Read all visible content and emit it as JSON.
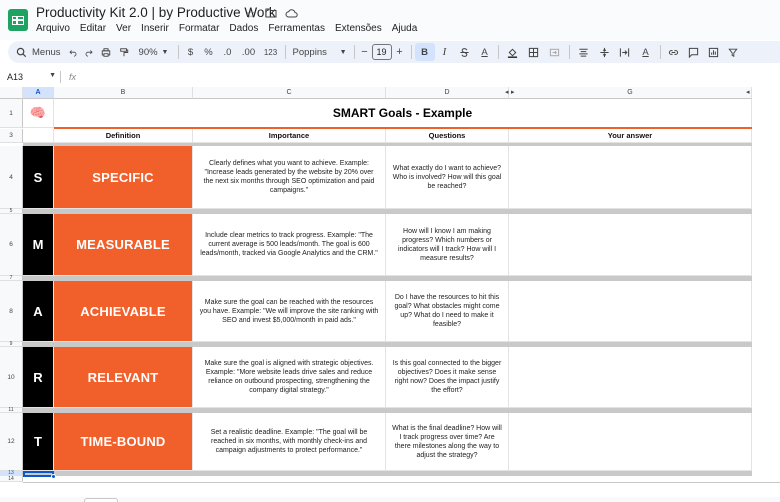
{
  "app": {
    "title": "Productivity Kit 2.0 | by Productive Work",
    "icons": [
      "star-icon",
      "folder-icon",
      "cloud-icon"
    ]
  },
  "menu": [
    "Arquivo",
    "Editar",
    "Ver",
    "Inserir",
    "Formatar",
    "Dados",
    "Ferramentas",
    "Extensões",
    "Ajuda"
  ],
  "toolbar": {
    "search_label": "Menus",
    "zoom": "90%",
    "currency": "$",
    "percent": "%",
    "decrease_decimals": ".0",
    "increase_decimals": ".00",
    "number_format": "123",
    "font": "Poppins",
    "font_size": "19",
    "bold": "B",
    "italic": "I",
    "text_color": "A",
    "more_formats": "A"
  },
  "formula_bar": {
    "name_box": "A13",
    "fx": "fx",
    "content": ""
  },
  "columns": [
    "A",
    "B",
    "C",
    "D",
    "G"
  ],
  "rows": [
    "1",
    "3",
    "4",
    "5",
    "6",
    "7",
    "8",
    "9",
    "10",
    "11",
    "12",
    "13",
    "14"
  ],
  "sheet": {
    "emoji": "🧠",
    "title": "SMART Goals - Example",
    "headers": {
      "definition": "Definition",
      "importance": "Importance",
      "questions": "Questions",
      "answer": "Your answer"
    },
    "goals": [
      {
        "letter": "S",
        "label": "SPECIFIC",
        "importance": "Clearly defines what you want to achieve. Example: \"Increase leads generated by the website by 20% over the next six months through SEO optimization and paid campaigns.\"",
        "questions": "What exactly do I want to achieve? Who is involved? How will this goal be reached?",
        "answer": ""
      },
      {
        "letter": "M",
        "label": "MEASURABLE",
        "importance": "Include clear metrics to track progress. Example: \"The current average is 500 leads/month. The goal is 600 leads/month, tracked via Google Analytics and the CRM.\"",
        "questions": "How will I know I am making progress? Which numbers or indicators will I track? How will I measure results?",
        "answer": ""
      },
      {
        "letter": "A",
        "label": "ACHIEVABLE",
        "importance": "Make sure the goal can be reached with the resources you have. Example: \"We will improve the site ranking with SEO and invest $5,000/month in paid ads.\"",
        "questions": "Do I have the resources to hit this goal? What obstacles might come up? What do I need to make it feasible?",
        "answer": ""
      },
      {
        "letter": "R",
        "label": "RELEVANT",
        "importance": "Make sure the goal is aligned with strategic objectives. Example: \"More website leads drive sales and reduce reliance on outbound prospecting, strengthening the company digital strategy.\"",
        "questions": "Is this goal connected to the bigger objectives? Does it make sense right now? Does the impact justify the effort?",
        "answer": ""
      },
      {
        "letter": "T",
        "label": "TIME-BOUND",
        "importance": "Set a realistic deadline. Example: \"The goal will be reached in six months, with monthly check-ins and campaign adjustments to protect performance.\"",
        "questions": "What is the final deadline? How will I track progress over time? Are there milestones along the way to adjust the strategy?",
        "answer": ""
      }
    ]
  },
  "colors": {
    "accent_orange": "#f15f2a",
    "letter_bg": "#000000",
    "selection": "#0b57d0",
    "sheets_green": "#1ea362"
  }
}
